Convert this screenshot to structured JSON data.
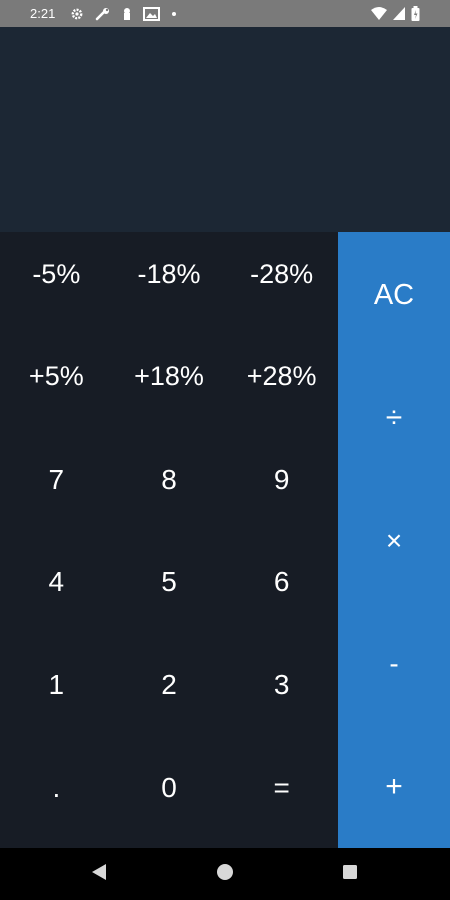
{
  "status_bar": {
    "time": "2:21",
    "left_icons": [
      "gear-icon",
      "wrench-icon",
      "keyhole-icon",
      "image-icon",
      "dot-icon"
    ],
    "right_icons": [
      "wifi-icon",
      "signal-icon",
      "battery-icon"
    ]
  },
  "display": {
    "value": ""
  },
  "keypad": {
    "rows": [
      [
        "-5%",
        "-18%",
        "-28%"
      ],
      [
        "+5%",
        "+18%",
        "+28%"
      ],
      [
        "7",
        "8",
        "9"
      ],
      [
        "4",
        "5",
        "6"
      ],
      [
        "1",
        "2",
        "3"
      ],
      [
        ".",
        "0",
        "="
      ]
    ]
  },
  "operators": {
    "clear": "AC",
    "divide": "÷",
    "multiply": "×",
    "subtract": "-",
    "add": "+"
  },
  "colors": {
    "display_bg": "#1c2734",
    "keypad_bg": "#171c25",
    "operator_bg": "#2a7cc7",
    "status_bar_bg": "#7a7a7a"
  },
  "nav_bar": {
    "icons": [
      "back-icon",
      "home-icon",
      "recents-icon"
    ]
  }
}
